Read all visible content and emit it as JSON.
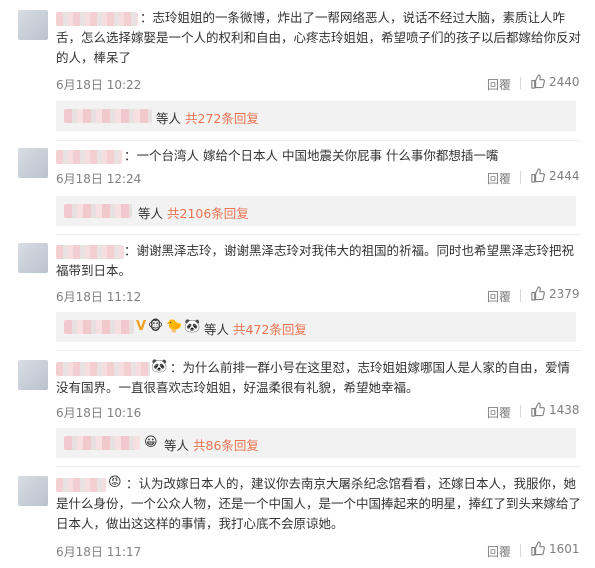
{
  "comments": [
    {
      "text": "：志玲姐姐的一条微博，炸出了一帮网络恶人，说话不经过大脑，素质让人咋舌，怎么选择嫁娶是一个人的权利和自由，心疼志玲姐姐，希望喷子们的孩子以后都嫁给你反对的人，棒呆了",
      "time": "6月18日 10:22",
      "reply_label": "回覆",
      "likes": "2440",
      "sub_prefix": "等人",
      "sub_count": "共272条回复"
    },
    {
      "text": "：一个台湾人 嫁给个日本人 中国地震关你屁事 什么事你都想插一嘴",
      "time": "6月18日 12:24",
      "reply_label": "回覆",
      "likes": "2444",
      "sub_prefix": "等人",
      "sub_count": "共2106条回复"
    },
    {
      "text": "：谢谢黑泽志玲，谢谢黑泽志玲对我伟大的祖国的祈福。同时也希望黑泽志玲把祝福带到日本。",
      "time": "6月18日 11:12",
      "reply_label": "回覆",
      "likes": "2379",
      "sub_prefix": "等人",
      "sub_count": "共472条回复"
    },
    {
      "text": "：为什么前排一群小号在这里怼，志玲姐姐嫁哪国人是人家的自由，爱情没有国界。一直很喜欢志玲姐姐，好温柔很有礼貌，希望她幸福。",
      "time": "6月18日 10:16",
      "reply_label": "回覆",
      "likes": "1438",
      "sub_prefix": "等人",
      "sub_count": "共86条回复"
    },
    {
      "text": "：认为改嫁日本人的，建议你去南京大屠杀纪念馆看看，还嫁日本人，我服你，她是什么身份，一个公众人物，还是一个中国人，是一个中国捧起来的明星，捧红了到头来嫁给了日本人，做出这这样的事情，我打心底不会原谅她。",
      "time": "6月18日 11:17",
      "reply_label": "回覆",
      "likes": "1601"
    }
  ],
  "sub_emojis": {
    "c3": [
      "V",
      "🐵",
      "🐤",
      "🐼"
    ],
    "c4": [
      "😀"
    ]
  },
  "name_emojis": {
    "c4": "🐼",
    "c5": "😡"
  }
}
